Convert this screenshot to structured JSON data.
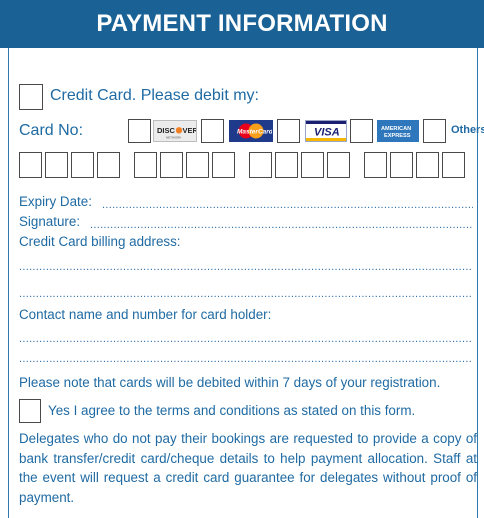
{
  "header": {
    "title": "PAYMENT INFORMATION"
  },
  "credit_card": {
    "checkbox_label": "Credit Card. Please debit my:",
    "card_no_label": "Card No:",
    "card_types": [
      {
        "name": "DISCOVER",
        "icon": "discover-logo-icon",
        "color": "#e7e7e7",
        "accent": "#f48024"
      },
      {
        "name": "MasterCard",
        "icon": "mastercard-logo-icon",
        "color": "#1f3a8a",
        "accent": "#eb001b"
      },
      {
        "name": "VISA",
        "icon": "visa-logo-icon",
        "color": "#ffffff",
        "accent": "#1a1f71"
      },
      {
        "name": "AMERICAN EXPRESS",
        "icon": "amex-logo-icon",
        "color": "#2e77bc",
        "accent": "#ffffff"
      }
    ],
    "others_label": "Others",
    "digit_groups": 4,
    "digits_per_group": 4
  },
  "fields": {
    "expiry_label": "Expiry Date:",
    "signature_label": "Signature:",
    "billing_address_label": "Credit Card billing address:",
    "contact_label": "Contact name and number for card holder:"
  },
  "notes": {
    "debit_note": "Please note that cards will be debited within 7 days of your registration.",
    "agree_label": "Yes I agree to the terms and conditions as stated on this form.",
    "delegates_note": "Delegates who do not pay their bookings are requested to provide a copy of bank transfer/credit card/cheque details to help payment allocation. Staff at the event will request a credit card guarantee for delegates without proof of payment."
  },
  "colors": {
    "header_bg": "#1a6296",
    "text_blue": "#1f6aa3"
  }
}
